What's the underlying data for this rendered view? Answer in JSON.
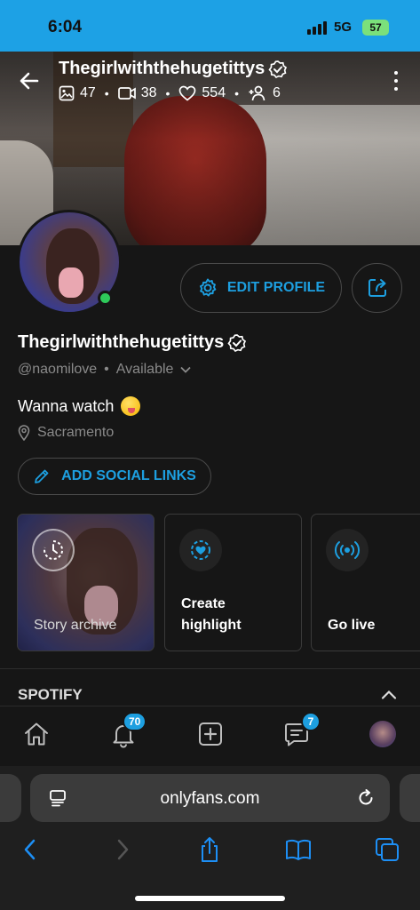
{
  "status_bar": {
    "time": "6:04",
    "network": "5G",
    "battery": "57"
  },
  "header": {
    "title": "Thegirlwiththehugetittys",
    "stats": {
      "photos": "47",
      "videos": "38",
      "likes": "554",
      "fans": "6"
    }
  },
  "profile": {
    "edit_label": "EDIT PROFILE",
    "name": "Thegirlwiththehugetittys",
    "handle": "@naomilove",
    "availability": "Available",
    "bio": "Wanna watch",
    "location": "Sacramento",
    "social_label": "ADD SOCIAL LINKS"
  },
  "cards": {
    "archive": "Story archive",
    "highlight": "Create highlight",
    "live": "Go live"
  },
  "spotify": {
    "title": "SPOTIFY"
  },
  "tabbar": {
    "notifications_badge": "70",
    "messages_badge": "7"
  },
  "browser": {
    "url": "onlyfans.com"
  },
  "colors": {
    "accent": "#1d9fe0",
    "online": "#2ec95a",
    "background": "#161616"
  }
}
